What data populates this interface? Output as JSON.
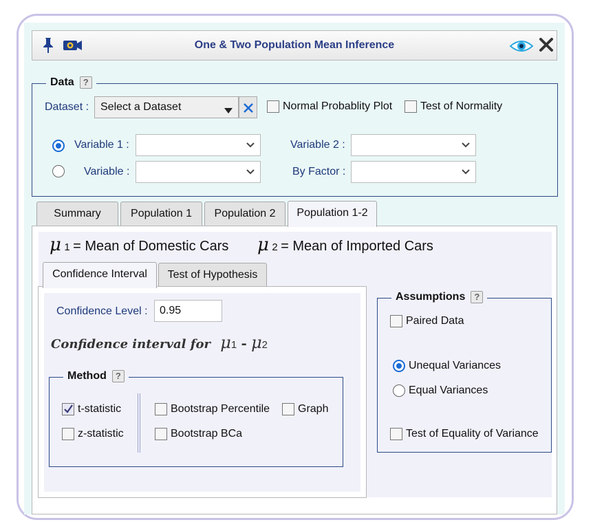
{
  "window": {
    "title": "One & Two Population Mean Inference"
  },
  "icons": {
    "pin": "pin-icon",
    "camera": "camera-icon",
    "eye": "eye-icon",
    "close": "close-icon",
    "help": "?"
  },
  "data_section": {
    "legend": "Data",
    "dataset_label": "Dataset :",
    "dataset_value": "Select a Dataset",
    "clear_symbol": "✕",
    "normal_plot": "Normal Probablity Plot",
    "normality_test": "Test of Normality",
    "variable1_label": "Variable 1 :",
    "variable2_label": "Variable 2 :",
    "variable_label": "Variable :",
    "by_factor_label": "By Factor :",
    "variable1_value": "",
    "variable2_value": "",
    "variable_value": "",
    "by_factor_value": ""
  },
  "tabs": [
    {
      "label": "Summary"
    },
    {
      "label": "Population 1"
    },
    {
      "label": "Population 2"
    },
    {
      "label": "Population 1-2",
      "active": true
    }
  ],
  "population_header": {
    "mu": "μ",
    "sub1": "1",
    "sub2": "2",
    "mean1_text": "= Mean of Domestic Cars",
    "mean2_text": "= Mean of Imported Cars"
  },
  "subtabs": [
    {
      "label": "Confidence Interval",
      "active": true
    },
    {
      "label": "Test of Hypothesis"
    }
  ],
  "confidence": {
    "level_label": "Confidence Level :",
    "level_value": "0.95",
    "interval_label": "Confidence interval for",
    "minus": "-"
  },
  "method": {
    "legend": "Method",
    "t_statistic": "t-statistic",
    "z_statistic": "z-statistic",
    "bootstrap_percentile": "Bootstrap Percentile",
    "bootstrap_bca": "Bootstrap BCa",
    "graph": "Graph"
  },
  "assumptions": {
    "legend": "Assumptions",
    "paired": "Paired Data",
    "unequal": "Unequal Variances",
    "equal": "Equal Variances",
    "equality_test": "Test of Equality of Variance"
  },
  "colors": {
    "accent": "#1a6bd6",
    "title_text": "#2c3f86",
    "label_text": "#1d3a7a",
    "frame_bg": "#eaf7f7"
  }
}
